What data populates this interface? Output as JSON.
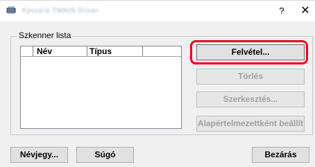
{
  "window": {
    "title": "Kyocera TWAIN Driver",
    "help_glyph": "?",
    "close_glyph": "✕",
    "icon": "scanner-app-icon"
  },
  "scanner_list": {
    "group_label": "Szkenner lista",
    "columns": [
      "Név",
      "Típus"
    ],
    "rows": []
  },
  "side_buttons": {
    "add": "Felvétel...",
    "delete": "Törlés",
    "edit": "Szerkesztés...",
    "set_default": "Alapértelmezettként beállít"
  },
  "footer_buttons": {
    "about": "Névjegy...",
    "help": "Súgó",
    "close": "Bezárás"
  },
  "colors": {
    "highlight": "#e8001f",
    "dialog_bg": "#f0f0f0",
    "disabled_text": "#a0a0a0"
  }
}
